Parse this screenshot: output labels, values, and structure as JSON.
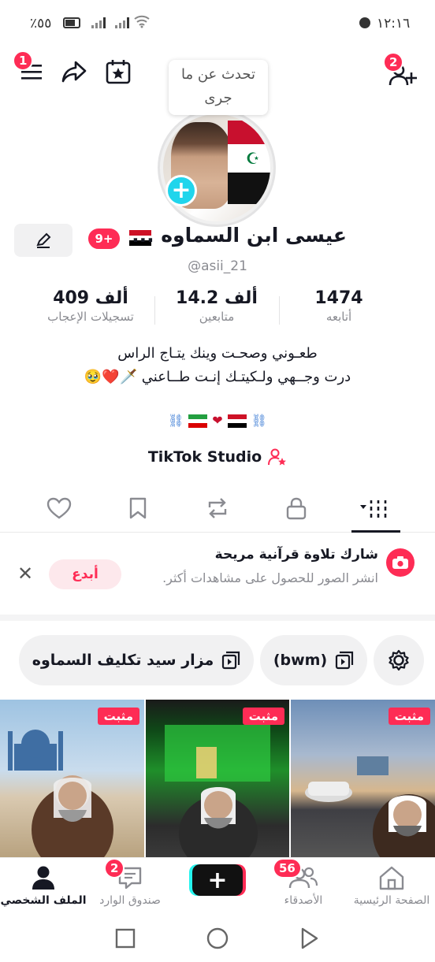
{
  "status_bar": {
    "time": "١٢:١٦",
    "battery": "٪٥٥"
  },
  "top_bar": {
    "menu_badge": "1",
    "add_friend_badge": "2"
  },
  "note_bubble": {
    "text_line1": "تحدث عن ما",
    "text_line2": "جرى"
  },
  "profile": {
    "name": "عيسى ابن السماوه ...",
    "notifications_badge": "9+",
    "handle": "@asii_21",
    "stats": [
      {
        "value": "1474",
        "label": "أتابعه"
      },
      {
        "value": "14.2 ألف",
        "label": "متابعين"
      },
      {
        "value": "409 ألف",
        "label": "تسجيلات الإعجاب"
      }
    ],
    "bio_line1": "طعـوني وصحـت وينك يتـاج الراس",
    "bio_line2": "درت وجــهي ولـكيتـك إنـت طــاعني 🗡️❤️🥹",
    "studio_label": "TikTok Studio"
  },
  "promo": {
    "title": "شارك تلاوة قرآنية مريحة",
    "description": "انشر الصور للحصول على مشاهدات أكثر.",
    "create_label": "أبدع"
  },
  "chips": [
    {
      "label": "مزار سيد تكليف السماوه"
    },
    {
      "label": "(bwm)"
    }
  ],
  "videos": [
    {
      "pinned": "مثبت"
    },
    {
      "pinned": "مثبت"
    },
    {
      "pinned": "مثبت"
    }
  ],
  "bottom_nav": {
    "home": "الصفحة الرئيسية",
    "friends": "الأصدقاء",
    "friends_badge": "56",
    "inbox": "صندوق الوارد",
    "inbox_badge": "2",
    "profile": "الملف الشخصي"
  },
  "colors": {
    "accent": "#fe2c55",
    "cyan": "#20d5ec",
    "text": "#161823",
    "muted": "#8a8b91"
  }
}
